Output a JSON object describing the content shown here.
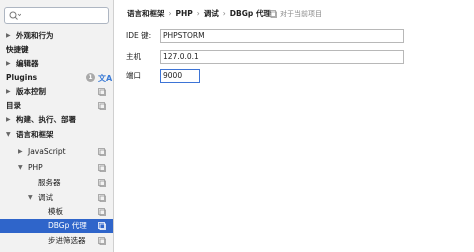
{
  "search": {
    "placeholder": ""
  },
  "sidebar": {
    "items": [
      {
        "label": "外观和行为",
        "arrow": "▶",
        "bold": true
      },
      {
        "label": "快捷键",
        "arrow": "",
        "bold": true
      },
      {
        "label": "编辑器",
        "arrow": "▶",
        "bold": true
      },
      {
        "label": "Plugins",
        "arrow": "",
        "bold": true,
        "badge": "1"
      },
      {
        "label": "版本控制",
        "arrow": "▶",
        "bold": true
      },
      {
        "label": "目录",
        "arrow": "",
        "bold": true
      },
      {
        "label": "构建、执行、部署",
        "arrow": "▶",
        "bold": true
      },
      {
        "label": "语言和框架",
        "arrow": "▼",
        "bold": true
      },
      {
        "label": "JavaScript",
        "arrow": "▶",
        "bold": false
      },
      {
        "label": "PHP",
        "arrow": "▼",
        "bold": false
      },
      {
        "label": "服务器",
        "arrow": "",
        "bold": false
      },
      {
        "label": "调试",
        "arrow": "▼",
        "bold": false
      },
      {
        "label": "模板",
        "arrow": "",
        "bold": false
      },
      {
        "label": "DBGp 代理",
        "arrow": "",
        "bold": false,
        "selected": true
      },
      {
        "label": "步进筛选器",
        "arrow": "",
        "bold": false
      }
    ]
  },
  "breadcrumb": {
    "items": [
      "语言和框架",
      "PHP",
      "调试",
      "DBGp 代理"
    ],
    "separator": "›",
    "project_note": "对于当前项目"
  },
  "form": {
    "ide_key_label": "IDE 键:",
    "ide_key_value": "PHPSTORM",
    "host_label": "主机",
    "host_value": "127.0.0.1",
    "port_label": "端口",
    "port_value": "9000"
  }
}
